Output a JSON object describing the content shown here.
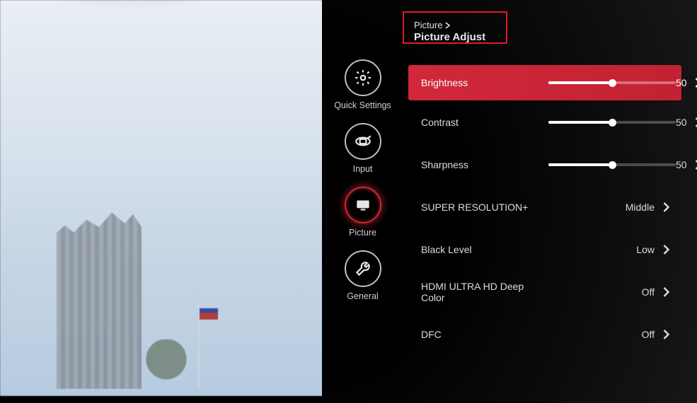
{
  "breadcrumb": {
    "parent": "Picture",
    "title": "Picture Adjust"
  },
  "sidebar": {
    "items": [
      {
        "label": "Quick Settings",
        "icon": "gear",
        "selected": false
      },
      {
        "label": "Input",
        "icon": "input",
        "selected": false
      },
      {
        "label": "Picture",
        "icon": "monitor",
        "selected": true
      },
      {
        "label": "General",
        "icon": "wrench",
        "selected": false
      }
    ]
  },
  "settings": [
    {
      "key": "brightness",
      "label": "Brightness",
      "type": "slider",
      "value": 50,
      "min": 0,
      "max": 100,
      "selected": true
    },
    {
      "key": "contrast",
      "label": "Contrast",
      "type": "slider",
      "value": 50,
      "min": 0,
      "max": 100,
      "selected": false
    },
    {
      "key": "sharpness",
      "label": "Sharpness",
      "type": "slider",
      "value": 50,
      "min": 0,
      "max": 100,
      "selected": false
    },
    {
      "key": "superres",
      "label": "SUPER RESOLUTION+",
      "type": "option",
      "value": "Middle",
      "selected": false
    },
    {
      "key": "blacklevel",
      "label": "Black Level",
      "type": "option",
      "value": "Low",
      "selected": false
    },
    {
      "key": "hdmideepcolor",
      "label": "HDMI ULTRA HD Deep Color",
      "type": "option",
      "value": "Off",
      "selected": false
    },
    {
      "key": "dfc",
      "label": "DFC",
      "type": "option",
      "value": "Off",
      "selected": false
    }
  ],
  "accent_color": "#d0283a"
}
